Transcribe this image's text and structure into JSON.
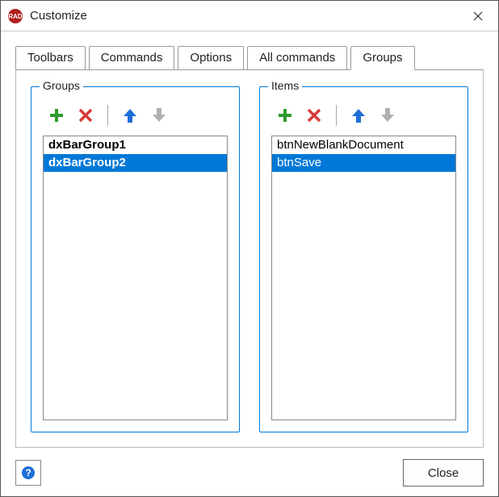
{
  "window": {
    "title": "Customize"
  },
  "tabs": {
    "toolbars": "Toolbars",
    "commands": "Commands",
    "options": "Options",
    "all_commands": "All commands",
    "groups": "Groups",
    "active": "groups"
  },
  "groups_panel": {
    "legend": "Groups",
    "items": [
      {
        "label": "dxBarGroup1",
        "selected": false,
        "bold": true
      },
      {
        "label": "dxBarGroup2",
        "selected": true,
        "bold": true
      }
    ]
  },
  "items_panel": {
    "legend": "Items",
    "items": [
      {
        "label": "btnNewBlankDocument",
        "selected": false,
        "bold": false
      },
      {
        "label": "btnSave",
        "selected": true,
        "bold": false
      }
    ]
  },
  "buttons": {
    "close": "Close"
  },
  "icons": {
    "add": "add-icon",
    "delete": "delete-icon",
    "up": "up-arrow-icon",
    "down": "down-arrow-icon",
    "help": "help-icon"
  },
  "colors": {
    "accent": "#0078d7",
    "add": "#2e9b2e",
    "delete": "#d83b3b",
    "up": "#1e6fd8",
    "disabled": "#b0b0b0"
  }
}
